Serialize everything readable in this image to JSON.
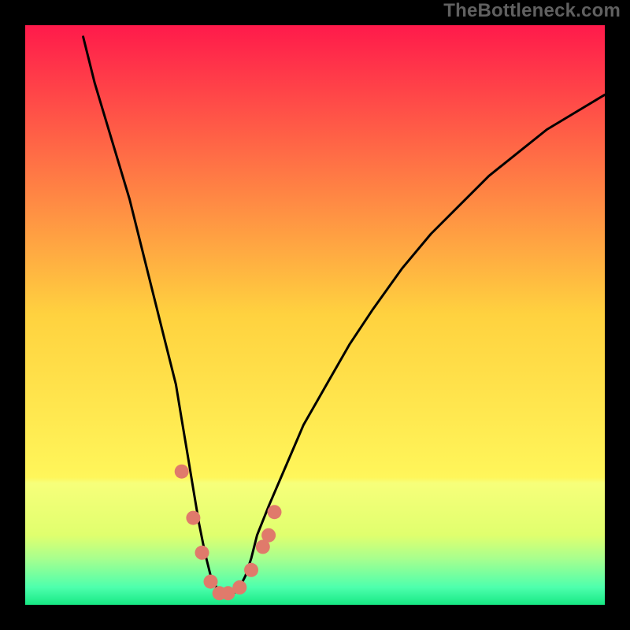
{
  "watermark": "TheBottleneck.com",
  "chart_data": {
    "type": "line",
    "title": "",
    "xlabel": "",
    "ylabel": "",
    "xlim": [
      0,
      100
    ],
    "ylim": [
      0,
      100
    ],
    "grid": false,
    "legend": false,
    "background_gradient": {
      "stops": [
        {
          "offset": 0.0,
          "color": "#ff1a4b"
        },
        {
          "offset": 0.5,
          "color": "#ffd23f"
        },
        {
          "offset": 0.78,
          "color": "#fff65a"
        },
        {
          "offset": 0.79,
          "color": "#f7ff7a"
        },
        {
          "offset": 0.88,
          "color": "#e0ff6e"
        },
        {
          "offset": 0.92,
          "color": "#a8ff8e"
        },
        {
          "offset": 0.97,
          "color": "#4dffad"
        },
        {
          "offset": 1.0,
          "color": "#17e884"
        }
      ]
    },
    "series": [
      {
        "name": "bottleneck_curve",
        "type": "line",
        "color": "#000000",
        "note": "V-shaped curve; y≈0 corresponds to no bottleneck (bottom green band).",
        "x": [
          10,
          12,
          15,
          18,
          20,
          22,
          24,
          26,
          27,
          28,
          29,
          30,
          31,
          32,
          33,
          34,
          35,
          36,
          37,
          38,
          39,
          40,
          42,
          45,
          48,
          52,
          56,
          60,
          65,
          70,
          75,
          80,
          85,
          90,
          95,
          100
        ],
        "y": [
          98,
          90,
          80,
          70,
          62,
          54,
          46,
          38,
          32,
          26,
          20,
          14,
          9,
          5,
          3,
          2,
          2,
          2,
          3,
          5,
          8,
          12,
          17,
          24,
          31,
          38,
          45,
          51,
          58,
          64,
          69,
          74,
          78,
          82,
          85,
          88
        ]
      },
      {
        "name": "highlight_points",
        "type": "scatter",
        "color": "#e07a6b",
        "note": "Salmon dots along lower part of V.",
        "x": [
          27,
          29,
          30.5,
          32,
          33.5,
          35,
          37,
          39,
          41,
          43,
          42
        ],
        "y": [
          23,
          15,
          9,
          4,
          2,
          2,
          3,
          6,
          10,
          16,
          12
        ]
      }
    ]
  }
}
